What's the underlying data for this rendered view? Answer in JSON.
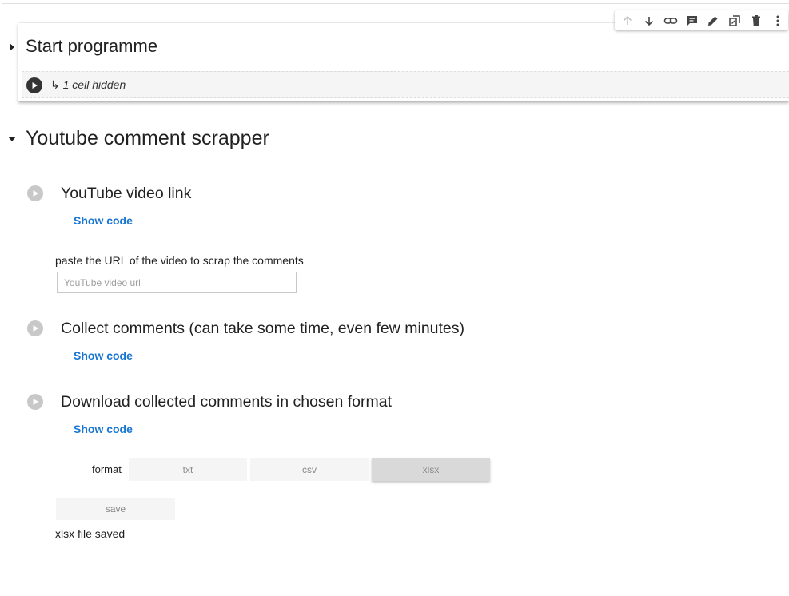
{
  "card": {
    "title": "Start programme",
    "hidden_icon": "↳",
    "hidden_text": "1 cell hidden"
  },
  "toolbar": {
    "icons": [
      "arrow-up-icon",
      "arrow-down-icon",
      "link-icon",
      "comment-icon",
      "edit-icon",
      "mirror-cell-icon",
      "delete-icon",
      "more-vert-icon"
    ]
  },
  "section": {
    "title": "Youtube comment scrapper"
  },
  "cells": {
    "video_link": {
      "title": "YouTube video link",
      "show_code": "Show code"
    },
    "collect": {
      "title": "Collect comments (can take some time, even few minutes)",
      "show_code": "Show code"
    },
    "download": {
      "title": "Download collected comments in chosen format",
      "show_code": "Show code"
    }
  },
  "url_field": {
    "label": "paste the URL of the video to scrap the comments",
    "placeholder": "YouTube video url",
    "value": ""
  },
  "format": {
    "label": "format",
    "options": [
      "txt",
      "csv",
      "xlsx"
    ],
    "selected": "xlsx"
  },
  "save_label": "save",
  "status_text": "xlsx file saved",
  "colors": {
    "link": "#1976d2",
    "run_button_inactive": "#c8c8c8",
    "run_button_active": "#333333"
  }
}
